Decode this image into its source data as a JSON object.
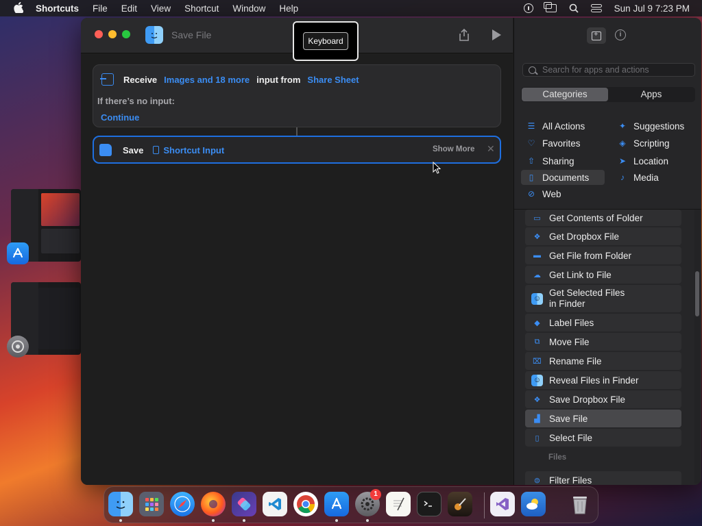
{
  "menubar": {
    "app": "Shortcuts",
    "items": [
      "File",
      "Edit",
      "View",
      "Shortcut",
      "Window",
      "Help"
    ],
    "clock": "Sun Jul 9  7:23 PM"
  },
  "window": {
    "title": "Save File",
    "tooltip": "Keyboard"
  },
  "receive_card": {
    "receive": "Receive",
    "types": "Images and 18 more",
    "input_from": "input from",
    "source": "Share Sheet",
    "no_input": "If there’s no input:",
    "continue": "Continue"
  },
  "save_card": {
    "label": "Save",
    "variable": "Shortcut Input",
    "show_more": "Show More",
    "close": "✕"
  },
  "sidebar": {
    "search_placeholder": "Search for apps and actions",
    "tabs": [
      "Categories",
      "Apps"
    ],
    "categories": [
      {
        "label": "All Actions",
        "icon": "list-icon"
      },
      {
        "label": "Suggestions",
        "icon": "sparkle-icon"
      },
      {
        "label": "Favorites",
        "icon": "heart-icon"
      },
      {
        "label": "Scripting",
        "icon": "scripting-icon"
      },
      {
        "label": "Sharing",
        "icon": "share-icon"
      },
      {
        "label": "Location",
        "icon": "location-icon"
      },
      {
        "label": "Documents",
        "icon": "document-icon"
      },
      {
        "label": "Media",
        "icon": "music-note-icon"
      },
      {
        "label": "Web",
        "icon": "compass-icon"
      }
    ],
    "actions": [
      {
        "label": "Get Contents of Folder",
        "icon": "folder-icon"
      },
      {
        "label": "Get Dropbox File",
        "icon": "dropbox-icon"
      },
      {
        "label": "Get File from Folder",
        "icon": "folder-icon"
      },
      {
        "label": "Get Link to File",
        "icon": "cloud-icon"
      },
      {
        "label": "Get Selected Files in Finder",
        "icon": "finder-icon"
      },
      {
        "label": "Label Files",
        "icon": "tag-icon"
      },
      {
        "label": "Move File",
        "icon": "move-icon"
      },
      {
        "label": "Rename File",
        "icon": "rename-icon"
      },
      {
        "label": "Reveal Files in Finder",
        "icon": "finder-icon"
      },
      {
        "label": "Save Dropbox File",
        "icon": "dropbox-icon"
      },
      {
        "label": "Save File",
        "icon": "save-icon"
      },
      {
        "label": "Select File",
        "icon": "document-icon"
      }
    ],
    "section": "Files",
    "section_actions": [
      {
        "label": "Filter Files",
        "icon": "filter-icon"
      }
    ]
  },
  "dock": {
    "apps": [
      "Finder",
      "Launchpad",
      "Safari",
      "Firefox",
      "Shortcuts",
      "Visual Studio Code",
      "Chrome",
      "App Store",
      "System Settings",
      "TextEdit",
      "Terminal",
      "GarageBand",
      "Visual Studio",
      "Weather",
      "Trash"
    ],
    "settings_badge": "1"
  },
  "colors": {
    "accent": "#3b8df3",
    "window_bg": "#1e1e1e",
    "sidebar_bg": "#262628"
  }
}
